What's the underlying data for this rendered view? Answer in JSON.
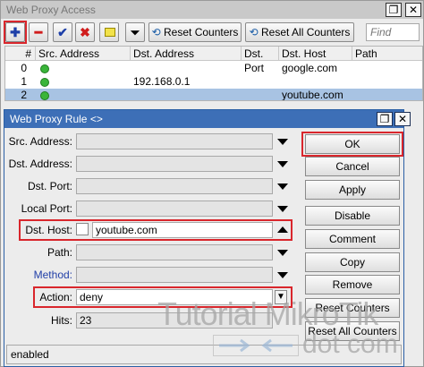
{
  "outer_window": {
    "title": "Web Proxy Access",
    "restore_glyph": "❐",
    "close_glyph": "✕",
    "toolbar": {
      "reset_counters": "Reset Counters",
      "reset_all_counters": "Reset All Counters",
      "find_placeholder": "Find"
    },
    "columns": [
      "#",
      "Src. Address",
      "Dst. Address",
      "Dst. Port",
      "Dst. Host",
      "Path"
    ],
    "rows": [
      {
        "num": "0",
        "src": "",
        "dst": "",
        "port": "",
        "host": "google.com",
        "path": ""
      },
      {
        "num": "1",
        "src": "",
        "dst": "192.168.0.1",
        "port": "",
        "host": "",
        "path": ""
      },
      {
        "num": "2",
        "src": "",
        "dst": "",
        "port": "",
        "host": "youtube.com",
        "path": "",
        "selected": true
      }
    ]
  },
  "dialog": {
    "title": "Web Proxy Rule <>",
    "fields": {
      "src_address": {
        "label": "Src. Address:",
        "value": ""
      },
      "dst_address": {
        "label": "Dst. Address:",
        "value": ""
      },
      "dst_port": {
        "label": "Dst. Port:",
        "value": ""
      },
      "local_port": {
        "label": "Local Port:",
        "value": ""
      },
      "dst_host": {
        "label": "Dst. Host:",
        "value": "youtube.com"
      },
      "path": {
        "label": "Path:",
        "value": ""
      },
      "method": {
        "label": "Method:",
        "value": ""
      },
      "action": {
        "label": "Action:",
        "value": "deny"
      },
      "hits": {
        "label": "Hits:",
        "value": "23"
      }
    },
    "buttons": {
      "ok": "OK",
      "cancel": "Cancel",
      "apply": "Apply",
      "disable": "Disable",
      "comment": "Comment",
      "copy": "Copy",
      "remove": "Remove",
      "reset_counters": "Reset Counters",
      "reset_all_counters": "Reset All Counters"
    },
    "status": "enabled"
  },
  "watermark": {
    "line1": "Tutorial MikroTik",
    "line2": "dot com"
  },
  "colors": {
    "highlight_red": "#d9262c",
    "dialog_title_bg": "#3d6fb7",
    "row_selected": "#a8c3e3"
  }
}
